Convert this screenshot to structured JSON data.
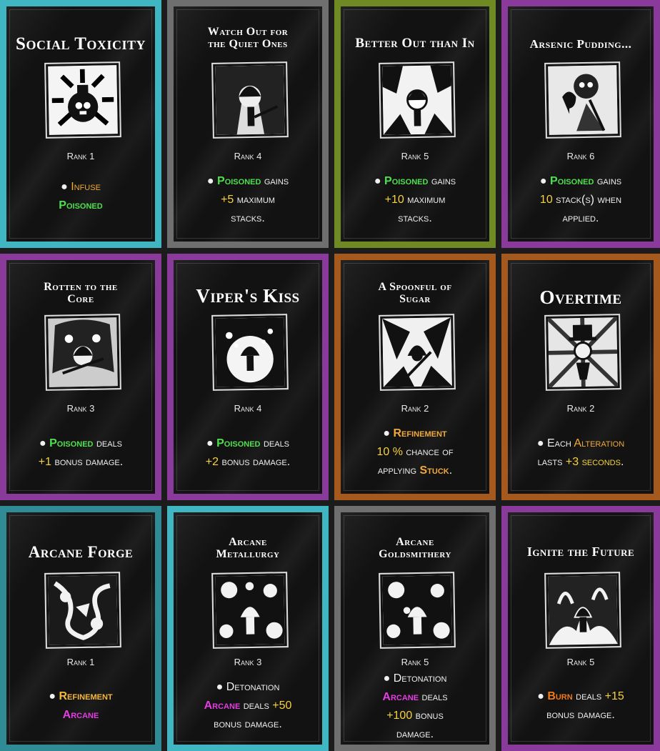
{
  "cards": [
    {
      "title": "Social Toxicity",
      "rank": "Rank 1",
      "lines": [
        {
          "pre": "● ",
          "a": "Infuse",
          "mid": "",
          "b": "",
          "post": ""
        },
        {
          "pre": "",
          "a": "Poisoned",
          "mid": "",
          "b": "",
          "post": ""
        }
      ]
    },
    {
      "title_1": "Watch Out for",
      "title_2": "the Quiet Ones",
      "rank": "Rank 4",
      "l1a": "Poisoned",
      "l1b": " gains",
      "l2a": "+5",
      "l2b": " maximum",
      "l3": "stacks."
    },
    {
      "title": "Better Out than In",
      "rank": "Rank 5",
      "l1a": "Poisoned",
      "l1b": " gains",
      "l2a": "+10",
      "l2b": " maximum",
      "l3": "stacks."
    },
    {
      "title": "Arsenic Pudding...",
      "rank": "Rank 6",
      "l1a": "Poisoned",
      "l1b": " gains",
      "l2a": "10",
      "l2b": " stack(s) when",
      "l3": "applied."
    },
    {
      "title_1": "Rotten to the",
      "title_2": "Core",
      "rank": "Rank 3",
      "l1a": "Poisoned",
      "l1b": " deals",
      "l2a": "+1",
      "l2b": " bonus damage."
    },
    {
      "title": "Viper's Kiss",
      "rank": "Rank 4",
      "l1a": "Poisoned",
      "l1b": " deals",
      "l2a": "+2",
      "l2b": " bonus damage."
    },
    {
      "title_1": "A Spoonful of",
      "title_2": "Sugar",
      "rank": "Rank 2",
      "l1": "Refinement",
      "l2a": "10 %",
      "l2b": " chance of",
      "l3a": "applying ",
      "l3b": "Stuck",
      "l3c": "."
    },
    {
      "title": "Overtime",
      "rank": "Rank 2",
      "l1a": "Each ",
      "l1b": "Alteration",
      "l2a": "lasts ",
      "l2b": "+3 seconds",
      "l2c": "."
    },
    {
      "title": "Arcane Forge",
      "rank": "Rank 1",
      "l1": "Refinement",
      "l2": "Arcane"
    },
    {
      "title_1": "Arcane",
      "title_2": "Metallurgy",
      "rank": "Rank 3",
      "l1": "Detonation",
      "l2a": "Arcane",
      "l2b": " deals ",
      "l2c": "+50",
      "l3": "bonus damage."
    },
    {
      "title_1": "Arcane",
      "title_2": "Goldsmithery",
      "rank": "Rank 5",
      "l1": "Detonation",
      "l2a": "Arcane",
      "l2b": " deals",
      "l3a": "+100",
      "l3b": " bonus",
      "l4": "damage."
    },
    {
      "title": "Ignite the Future",
      "rank": "Rank 5",
      "l1a": "Burn",
      "l1b": " deals ",
      "l1c": "+15",
      "l2": "bonus damage."
    }
  ],
  "bullet": "●"
}
